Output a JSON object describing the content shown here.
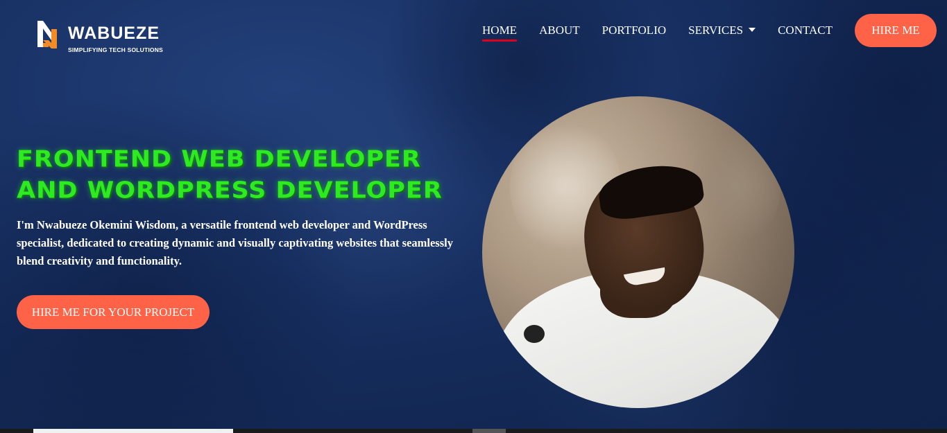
{
  "brand": {
    "name": "WABUEZE",
    "tagline": "SIMPLIFYING TECH SOLUTIONS",
    "colors": {
      "accent": "#ff6347",
      "headline": "#2eea21",
      "active_underline": "#e0001b",
      "logo_orange": "#f28c28"
    }
  },
  "nav": {
    "items": [
      {
        "label": "HOME",
        "active": true
      },
      {
        "label": "ABOUT",
        "active": false
      },
      {
        "label": "PORTFOLIO",
        "active": false
      },
      {
        "label": "SERVICES",
        "active": false,
        "dropdown": true
      },
      {
        "label": "CONTACT",
        "active": false
      }
    ],
    "hire_label": "HIRE ME"
  },
  "hero": {
    "title_line1": "FRONTEND WEB DEVELOPER",
    "title_line2": "AND WORDPRESS DEVELOPER",
    "description": "I'm Nwabueze Okemini Wisdom, a versatile frontend web developer and WordPress specialist, dedicated to creating dynamic and visually captivating websites that seamlessly blend creativity and functionality.",
    "cta_label": "HIRE ME FOR YOUR PROJECT",
    "portrait_icon": "profile-photo"
  }
}
